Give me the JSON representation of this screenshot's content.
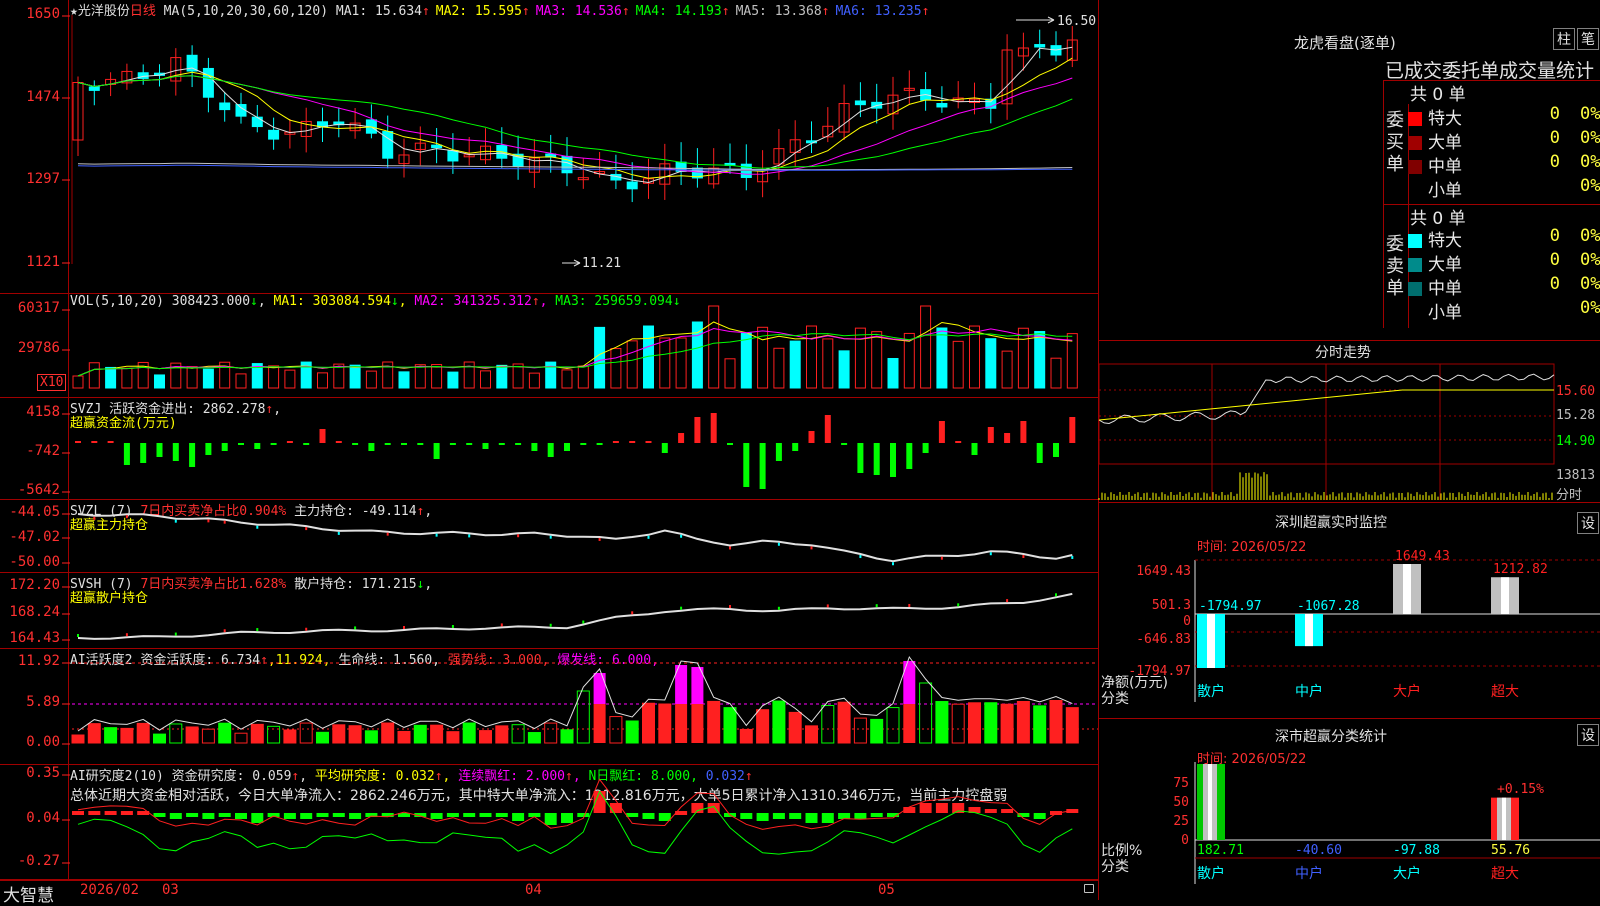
{
  "stock": {
    "name": "★光洋股份",
    "period": "日线"
  },
  "main": {
    "ma_label": "MA(5,10,20,30,60,120)",
    "ma": [
      {
        "label": "MA1:",
        "value": "15.634",
        "color": "#e0e0e0",
        "arrow": "↑"
      },
      {
        "label": "MA2:",
        "value": "15.595",
        "color": "#ffff00",
        "arrow": "↑"
      },
      {
        "label": "MA3:",
        "value": "14.536",
        "color": "#ff00ff",
        "arrow": "↑"
      },
      {
        "label": "MA4:",
        "value": "14.193",
        "color": "#00ff00",
        "arrow": "↑"
      },
      {
        "label": "MA5:",
        "value": "13.368",
        "color": "#c0c0c0",
        "arrow": "↑"
      },
      {
        "label": "MA6:",
        "value": "13.235",
        "color": "#4060ff",
        "arrow": "↑"
      }
    ],
    "axis": [
      "1650",
      "1474",
      "1297",
      "1121"
    ],
    "high_mark": "16.50",
    "low_mark": "11.21"
  },
  "vol": {
    "label": "VOL(5,10,20)",
    "value": "308423.000",
    "value_arrow": "↓",
    "ma1": "MA1: 303084.594",
    "ma1_arrow": "↓",
    "ma2": "MA2: 341325.312",
    "ma2_arrow": "↑",
    "ma3": "MA3: 259659.094",
    "ma3_arrow": "↓",
    "axis": [
      "60317",
      "29786"
    ],
    "unit": "X10"
  },
  "svzj": {
    "label": "SVZJ",
    "title": "活跃资金进出:",
    "value": "2862.278",
    "arrow": "↑",
    "tail": ",",
    "subtitle": "超赢资金流(万元)",
    "axis": [
      "4158",
      "-742",
      "-5642"
    ]
  },
  "svzl": {
    "label": "SVZL (7)",
    "t1": "7日内买卖净占比0.904%",
    "t2": "主力持仓:",
    "value": "-49.114",
    "arrow": "↑",
    "tail": ",",
    "subtitle": "超赢主力持仓",
    "axis": [
      "-44.05",
      "-47.02",
      "-50.00"
    ]
  },
  "svsh": {
    "label": "SVSH (7)",
    "t1": "7日内买卖净占比1.628%",
    "t2": "散户持仓:",
    "value": "171.215",
    "arrow": "↓",
    "tail": ",",
    "subtitle": "超赢散户持仓",
    "axis": [
      "172.20",
      "168.24",
      "164.43"
    ]
  },
  "ai1": {
    "label": "AI活跃度2",
    "t1": "资金活跃度:",
    "v1": "6.734",
    "a1": "↑",
    "v2": ",11.924,",
    "t3": "生命线:",
    "v3": "1.560,",
    "t4": "强势线:",
    "v4": "3.000,",
    "t5": "爆发线:",
    "v5": "6.000,",
    "axis": [
      "11.92",
      "5.89",
      "0.00"
    ]
  },
  "ai2": {
    "label": "AI研究度2(10)",
    "t1": "资金研究度:",
    "v1": "0.059",
    "a1": "↑",
    "t2": "平均研究度:",
    "v2": "0.032",
    "a2": "↑",
    "t3": "连续飘红:",
    "v3": "2.000",
    "a3": "↑",
    "t4": "N日飘红:",
    "v4": "8.000,",
    "v5": "0.032",
    "a5": "↑",
    "summary": "总体近期大资金相对活跃，今日大单净流入：2862.246万元，其中特大单净流入：1212.816万元，大单5日累计净入1310.346万元，当前主力控盘弱",
    "axis": [
      "0.35",
      "0.04",
      "-0.27"
    ]
  },
  "timeline": {
    "brand": "大智慧",
    "labels": [
      "2026/02",
      "03",
      "04",
      "05"
    ]
  },
  "lhb": {
    "title": "龙虎看盘(逐单)",
    "btn_bar": "柱",
    "btn_pen": "笔",
    "tabs": "已成交委托单成交量统计"
  },
  "ostat": {
    "buy_label": "委买单",
    "sell_label": "委卖单",
    "buy_total": "共 0 单",
    "sell_total": "共 0 单",
    "buy": [
      {
        "name": "特大",
        "vol": "0",
        "pct": "0%",
        "color": "#ff0000"
      },
      {
        "name": "大单",
        "vol": "0",
        "pct": "0%",
        "color": "#a00000"
      },
      {
        "name": "中单",
        "vol": "0",
        "pct": "0%",
        "color": "#800000"
      },
      {
        "name": "小单",
        "vol": "",
        "pct": "0%",
        "color": ""
      }
    ],
    "sell": [
      {
        "name": "特大",
        "vol": "0",
        "pct": "0%",
        "color": "#00ffff"
      },
      {
        "name": "大单",
        "vol": "0",
        "pct": "0%",
        "color": "#008b8b"
      },
      {
        "name": "中单",
        "vol": "0",
        "pct": "0%",
        "color": "#006e6e"
      },
      {
        "name": "小单",
        "vol": "",
        "pct": "0%",
        "color": ""
      }
    ]
  },
  "fenshi": {
    "title": "分时走势",
    "axis": [
      "15.60",
      "15.28",
      "14.90",
      "13813",
      "分时"
    ]
  },
  "szmon": {
    "title": "深圳超赢实时监控",
    "btn": "设",
    "time": "时间: 2026/05/22",
    "ylabel1": "净额(万元)",
    "ylabel2": "分类",
    "axis": [
      "1649.43",
      "501.3",
      "0",
      "-646.83",
      "-1794.97"
    ],
    "bars": [
      {
        "cat": "散户",
        "label": "-1794.97",
        "value": -1794.97
      },
      {
        "cat": "中户",
        "label": "-1067.28",
        "value": -1067.28
      },
      {
        "cat": "大户",
        "label": "1649.43",
        "value": 1649.43
      },
      {
        "cat": "超大",
        "label": "1212.82",
        "value": 1212.82
      }
    ]
  },
  "scstat": {
    "title": "深市超赢分类统计",
    "btn": "设",
    "time": "时间: 2026/05/22",
    "ylabel1": "比例%",
    "ylabel2": "分类",
    "axis": [
      "75",
      "50",
      "25",
      "0"
    ],
    "bars": [
      {
        "cat": "散户",
        "label": "182.71",
        "value": 182.71
      },
      {
        "cat": "中户",
        "label": "-40.60",
        "value": -40.6
      },
      {
        "cat": "大户",
        "label": "-97.88",
        "value": -97.88
      },
      {
        "cat": "超大",
        "label": "55.76",
        "value": 55.76
      }
    ],
    "annotation": "+0.15%"
  },
  "colors": {
    "up": "#ff2020",
    "down": "#00ffff",
    "grid": "#a00000",
    "axis": "#ff3030"
  }
}
